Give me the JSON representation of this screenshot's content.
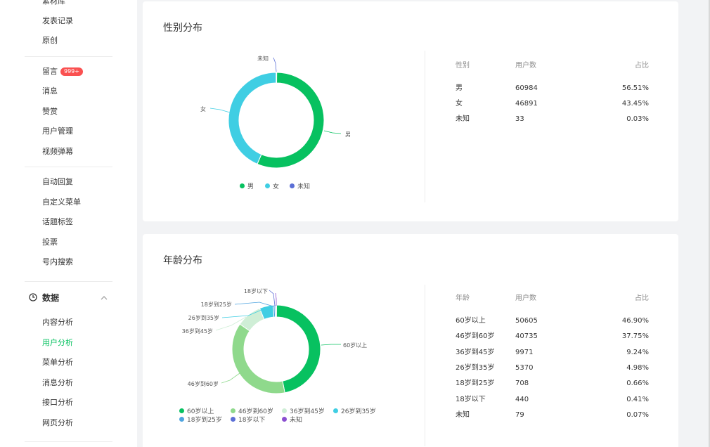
{
  "sidebar": {
    "items_top": [
      {
        "label": "素材库",
        "name": "sidebar-item-material-library"
      },
      {
        "label": "发表记录",
        "name": "sidebar-item-publish-record"
      },
      {
        "label": "原创",
        "name": "sidebar-item-original"
      }
    ],
    "items_mid": [
      {
        "label": "留言",
        "name": "sidebar-item-comments",
        "badge": "999+"
      },
      {
        "label": "消息",
        "name": "sidebar-item-messages"
      },
      {
        "label": "赞赏",
        "name": "sidebar-item-appreciation"
      },
      {
        "label": "用户管理",
        "name": "sidebar-item-user-management"
      },
      {
        "label": "视频弹幕",
        "name": "sidebar-item-video-danmaku"
      }
    ],
    "items_func": [
      {
        "label": "自动回复",
        "name": "sidebar-item-auto-reply"
      },
      {
        "label": "自定义菜单",
        "name": "sidebar-item-custom-menu"
      },
      {
        "label": "话题标签",
        "name": "sidebar-item-topic-tags"
      },
      {
        "label": "投票",
        "name": "sidebar-item-vote"
      },
      {
        "label": "号内搜索",
        "name": "sidebar-item-in-account-search"
      }
    ],
    "data_section": {
      "label": "数据",
      "icon": "clock-icon",
      "chevron": "chevron-up-icon"
    },
    "items_data": [
      {
        "label": "内容分析",
        "name": "sidebar-item-content-analysis"
      },
      {
        "label": "用户分析",
        "name": "sidebar-item-user-analysis",
        "active": true
      },
      {
        "label": "菜单分析",
        "name": "sidebar-item-menu-analysis"
      },
      {
        "label": "消息分析",
        "name": "sidebar-item-message-analysis"
      },
      {
        "label": "接口分析",
        "name": "sidebar-item-api-analysis"
      },
      {
        "label": "网页分析",
        "name": "sidebar-item-webpage-analysis"
      }
    ]
  },
  "gender": {
    "title": "性别分布",
    "table_headers": [
      "性别",
      "用户数",
      "占比"
    ],
    "rows": [
      {
        "label": "男",
        "count": "60984",
        "pct": "56.51%"
      },
      {
        "label": "女",
        "count": "46891",
        "pct": "43.45%"
      },
      {
        "label": "未知",
        "count": "33",
        "pct": "0.03%"
      }
    ]
  },
  "age": {
    "title": "年龄分布",
    "table_headers": [
      "年龄",
      "用户数",
      "占比"
    ],
    "rows": [
      {
        "label": "60岁以上",
        "count": "50605",
        "pct": "46.90%"
      },
      {
        "label": "46岁到60岁",
        "count": "40735",
        "pct": "37.75%"
      },
      {
        "label": "36岁到45岁",
        "count": "9971",
        "pct": "9.24%"
      },
      {
        "label": "26岁到35岁",
        "count": "5370",
        "pct": "4.98%"
      },
      {
        "label": "18岁到25岁",
        "count": "708",
        "pct": "0.66%"
      },
      {
        "label": "18岁以下",
        "count": "440",
        "pct": "0.41%"
      },
      {
        "label": "未知",
        "count": "79",
        "pct": "0.07%"
      }
    ]
  },
  "chart_data": [
    {
      "type": "pie",
      "title": "",
      "categories": [
        "男",
        "女",
        "未知"
      ],
      "values": [
        56.51,
        43.45,
        0.03
      ],
      "colors": [
        "#07c160",
        "#3fcee3",
        "#5b6fd6"
      ],
      "legend_position": "bottom",
      "donut": true
    },
    {
      "type": "pie",
      "title": "",
      "categories": [
        "60岁以上",
        "46岁到60岁",
        "36岁到45岁",
        "26岁到35岁",
        "18岁到25岁",
        "18岁以下",
        "未知"
      ],
      "values": [
        46.9,
        37.75,
        9.24,
        4.98,
        0.66,
        0.41,
        0.07
      ],
      "colors": [
        "#07c160",
        "#8fd98c",
        "#cfeed6",
        "#3fcee3",
        "#4ea4e0",
        "#5b6fd6",
        "#8a4fd0"
      ],
      "legend_position": "bottom",
      "donut": true
    }
  ]
}
